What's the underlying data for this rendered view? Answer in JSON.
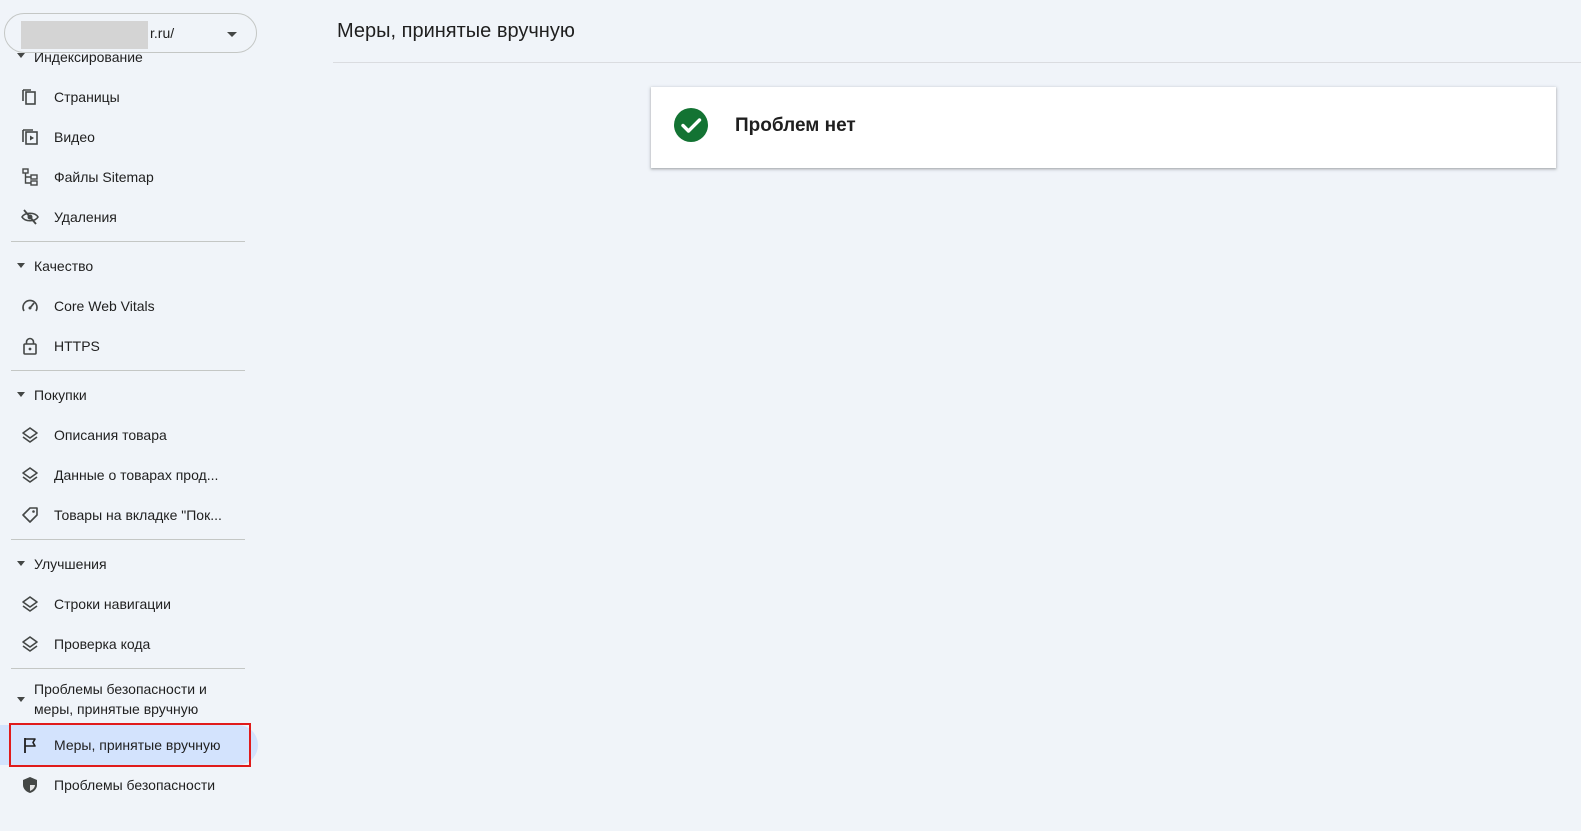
{
  "property": {
    "value": "r.ru/"
  },
  "sidebar": {
    "sections": [
      {
        "header": "Индексирование",
        "items": [
          {
            "label": "Страницы",
            "icon": "pages-icon"
          },
          {
            "label": "Видео",
            "icon": "video-icon"
          },
          {
            "label": "Файлы Sitemap",
            "icon": "sitemap-icon"
          },
          {
            "label": "Удаления",
            "icon": "removals-icon"
          }
        ]
      },
      {
        "header": "Качество",
        "items": [
          {
            "label": "Core Web Vitals",
            "icon": "gauge-icon"
          },
          {
            "label": "HTTPS",
            "icon": "lock-icon"
          }
        ]
      },
      {
        "header": "Покупки",
        "items": [
          {
            "label": "Описания товара",
            "icon": "layers-icon"
          },
          {
            "label": "Данные о товарах прод...",
            "icon": "layers-icon"
          },
          {
            "label": "Товары на вкладке \"Пок...",
            "icon": "tag-icon"
          }
        ]
      },
      {
        "header": "Улучшения",
        "items": [
          {
            "label": "Строки навигации",
            "icon": "layers-icon"
          },
          {
            "label": "Проверка кода",
            "icon": "layers-icon"
          }
        ]
      },
      {
        "header": "Проблемы безопасности и меры, принятые вручную",
        "items": [
          {
            "label": "Меры, принятые вручную",
            "icon": "flag-icon",
            "active": true
          },
          {
            "label": "Проблемы безопасности",
            "icon": "shield-icon"
          }
        ]
      }
    ]
  },
  "main": {
    "title": "Меры, принятые вручную",
    "status": "Проблем нет"
  },
  "colors": {
    "background": "#f0f4f9",
    "active_item": "#d3e3fd",
    "success": "#137333",
    "highlight": "#e01b1b"
  }
}
